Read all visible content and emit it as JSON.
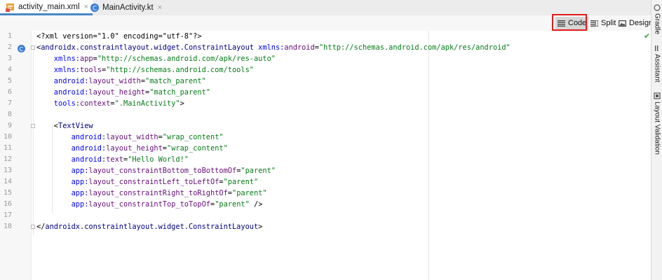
{
  "tabs": [
    {
      "label": "activity_main.xml",
      "close": "×",
      "icon": "xml-file-icon",
      "active": true
    },
    {
      "label": "MainActivity.kt",
      "close": "×",
      "icon": "kotlin-file-icon",
      "active": false
    }
  ],
  "view_modes": {
    "code": {
      "label": "Code",
      "icon": "code-lines-icon"
    },
    "split": {
      "label": "Split",
      "icon": "split-view-icon"
    },
    "design": {
      "label": "Design",
      "icon": "design-image-icon"
    }
  },
  "side_panels": {
    "gradle": "Gradle",
    "assistant": "Assistant",
    "layout_validation": "Layout Validation"
  },
  "inspection_status": "✔",
  "lines": [
    {
      "n": "1",
      "segs": [
        {
          "c": "t-decl",
          "t": "<?xml version=\"1.0\" encoding=\"utf-8\"?>"
        }
      ]
    },
    {
      "n": "2",
      "segs": [
        {
          "c": "t-punc",
          "t": "<"
        },
        {
          "c": "t-tag",
          "t": "androidx.constraintlayout.widget.ConstraintLayout "
        },
        {
          "c": "t-nsp",
          "t": "xmlns:"
        },
        {
          "c": "t-attr",
          "t": "android"
        },
        {
          "c": "t-punc",
          "t": "="
        },
        {
          "c": "t-str",
          "t": "\"http://schemas.android.com/apk/res/android\""
        }
      ]
    },
    {
      "n": "3",
      "segs": [
        {
          "c": "t-nsp",
          "t": "    xmlns:"
        },
        {
          "c": "t-attr",
          "t": "app"
        },
        {
          "c": "t-punc",
          "t": "="
        },
        {
          "c": "t-str",
          "t": "\"http://schemas.android.com/apk/res-auto\""
        }
      ]
    },
    {
      "n": "4",
      "segs": [
        {
          "c": "t-nsp",
          "t": "    xmlns:"
        },
        {
          "c": "t-attr",
          "t": "tools"
        },
        {
          "c": "t-punc",
          "t": "="
        },
        {
          "c": "t-str",
          "t": "\"http://schemas.android.com/tools\""
        }
      ]
    },
    {
      "n": "5",
      "segs": [
        {
          "c": "t-nsp",
          "t": "    android:"
        },
        {
          "c": "t-attr",
          "t": "layout_width"
        },
        {
          "c": "t-punc",
          "t": "="
        },
        {
          "c": "t-str",
          "t": "\"match_parent\""
        }
      ]
    },
    {
      "n": "6",
      "segs": [
        {
          "c": "t-nsp",
          "t": "    android:"
        },
        {
          "c": "t-attr",
          "t": "layout_height"
        },
        {
          "c": "t-punc",
          "t": "="
        },
        {
          "c": "t-str",
          "t": "\"match_parent\""
        }
      ]
    },
    {
      "n": "7",
      "segs": [
        {
          "c": "t-nsp",
          "t": "    tools:"
        },
        {
          "c": "t-attr",
          "t": "context"
        },
        {
          "c": "t-punc",
          "t": "="
        },
        {
          "c": "t-str",
          "t": "\".MainActivity\""
        },
        {
          "c": "t-punc",
          "t": ">"
        }
      ]
    },
    {
      "n": "8",
      "segs": []
    },
    {
      "n": "9",
      "segs": [
        {
          "c": "t-punc",
          "t": "    <"
        },
        {
          "c": "t-tag",
          "t": "TextView"
        }
      ]
    },
    {
      "n": "10",
      "segs": [
        {
          "c": "t-nsp",
          "t": "        android:"
        },
        {
          "c": "t-attr",
          "t": "layout_width"
        },
        {
          "c": "t-punc",
          "t": "="
        },
        {
          "c": "t-str",
          "t": "\"wrap_content\""
        }
      ]
    },
    {
      "n": "11",
      "segs": [
        {
          "c": "t-nsp",
          "t": "        android:"
        },
        {
          "c": "t-attr",
          "t": "layout_height"
        },
        {
          "c": "t-punc",
          "t": "="
        },
        {
          "c": "t-str",
          "t": "\"wrap_content\""
        }
      ]
    },
    {
      "n": "12",
      "segs": [
        {
          "c": "t-nsp",
          "t": "        android:"
        },
        {
          "c": "t-attr",
          "t": "text"
        },
        {
          "c": "t-punc",
          "t": "="
        },
        {
          "c": "t-str",
          "t": "\"Hello World!\""
        }
      ]
    },
    {
      "n": "13",
      "segs": [
        {
          "c": "t-nsp",
          "t": "        app:"
        },
        {
          "c": "t-attr",
          "t": "layout_constraintBottom_toBottomOf"
        },
        {
          "c": "t-punc",
          "t": "="
        },
        {
          "c": "t-str",
          "t": "\"parent\""
        }
      ]
    },
    {
      "n": "14",
      "segs": [
        {
          "c": "t-nsp",
          "t": "        app:"
        },
        {
          "c": "t-attr",
          "t": "layout_constraintLeft_toLeftOf"
        },
        {
          "c": "t-punc",
          "t": "="
        },
        {
          "c": "t-str",
          "t": "\"parent\""
        }
      ]
    },
    {
      "n": "15",
      "segs": [
        {
          "c": "t-nsp",
          "t": "        app:"
        },
        {
          "c": "t-attr",
          "t": "layout_constraintRight_toRightOf"
        },
        {
          "c": "t-punc",
          "t": "="
        },
        {
          "c": "t-str",
          "t": "\"parent\""
        }
      ]
    },
    {
      "n": "16",
      "segs": [
        {
          "c": "t-nsp",
          "t": "        app:"
        },
        {
          "c": "t-attr",
          "t": "layout_constraintTop_toTopOf"
        },
        {
          "c": "t-punc",
          "t": "="
        },
        {
          "c": "t-str",
          "t": "\"parent\""
        },
        {
          "c": "t-punc",
          "t": " />"
        }
      ]
    },
    {
      "n": "17",
      "segs": []
    },
    {
      "n": "18",
      "segs": [
        {
          "c": "t-punc",
          "t": "</"
        },
        {
          "c": "t-tag",
          "t": "androidx.constraintlayout.widget.ConstraintLayout"
        },
        {
          "c": "t-punc",
          "t": ">"
        }
      ]
    }
  ],
  "colors": {
    "selected_view_border": "#e21b1b",
    "active_tab_underline": "#4a88c7"
  }
}
